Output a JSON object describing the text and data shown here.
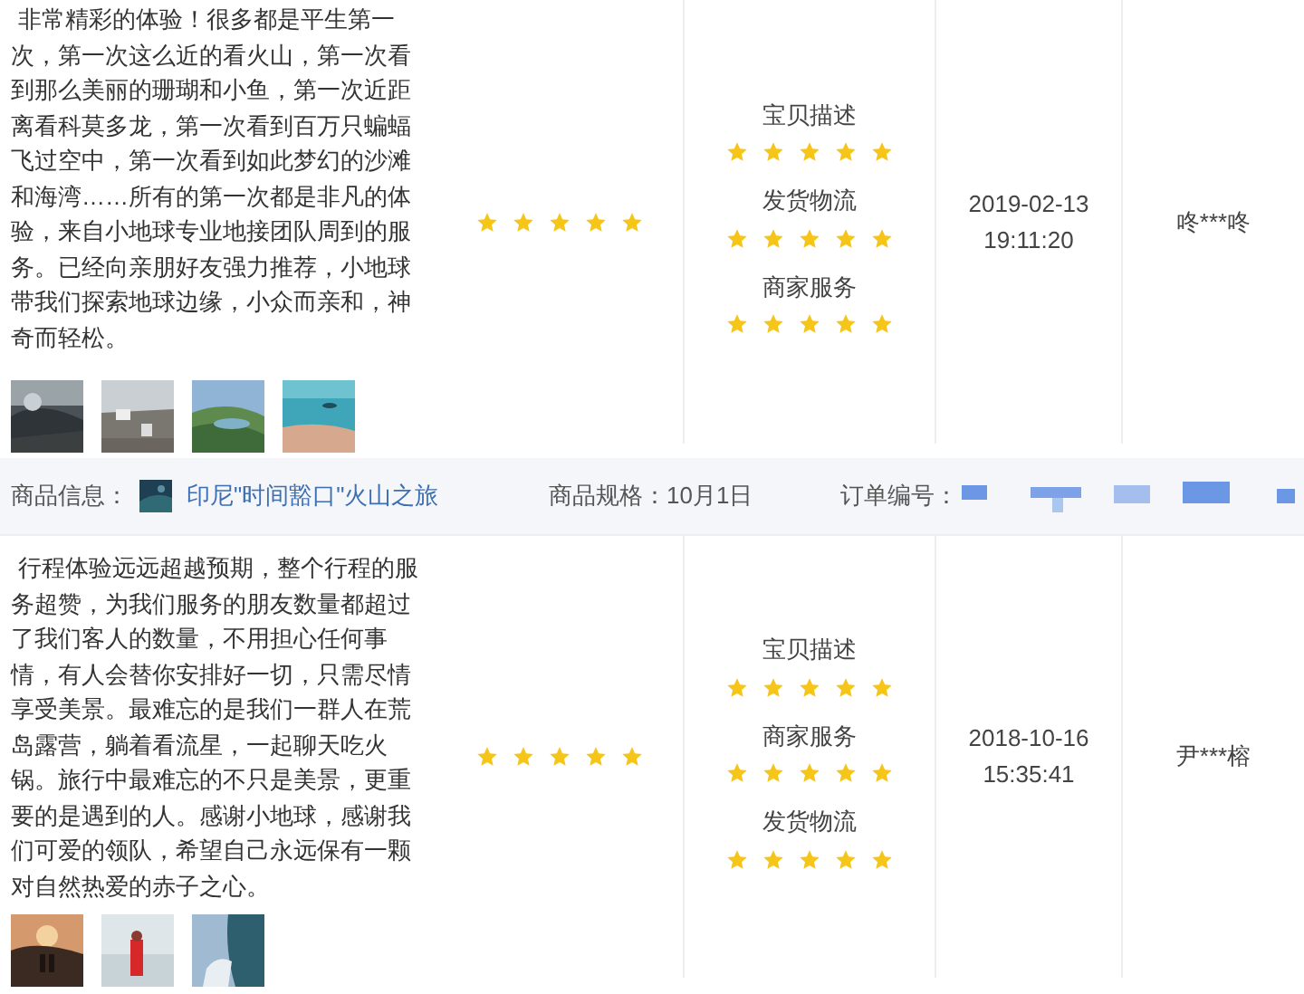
{
  "reviews": [
    {
      "comment": "非常精彩的体验！很多都是平生第一次，第一次这么近的看火山，第一次看到那么美丽的珊瑚和小鱼，第一次近距离看科莫多龙，第一次看到百万只蝙蝠飞过空中，第一次看到如此梦幻的沙滩和海湾……所有的第一次都是非凡的体验，来自小地球专业地接团队周到的服务。已经向亲朋好友强力推荐，小地球带我们探索地球边缘，小众而亲和，神奇而轻松。",
      "photos": [
        {
          "kind": "picture"
        },
        {
          "kind": "picture"
        },
        {
          "kind": "picture"
        },
        {
          "kind": "picture"
        }
      ],
      "stars": 5,
      "ratings": [
        {
          "label": "宝贝描述",
          "stars": 5
        },
        {
          "label": "发货物流",
          "stars": 5
        },
        {
          "label": "商家服务",
          "stars": 5
        }
      ],
      "date": "2019-02-13",
      "time": "19:11:20",
      "user": "咚***咚"
    },
    {
      "info": {
        "product_label": "商品信息：",
        "product": "印尼\"时间豁口\"火山之旅",
        "spec_label": "商品规格：",
        "spec": "10月1日",
        "order_label": "订单编号："
      },
      "comment": "行程体验远远超越预期，整个行程的服务超赞，为我们服务的朋友数量都超过了我们客人的数量，不用担心任何事情，有人会替你安排好一切，只需尽情享受美景。最难忘的是我们一群人在荒岛露营，躺着看流星，一起聊天吃火锅。旅行中最难忘的不只是美景，更重要的是遇到的人。感谢小地球，感谢我们可爱的领队，希望自己永远保有一颗对自然热爱的赤子之心。",
      "photos": [
        {
          "kind": "picture"
        },
        {
          "kind": "picture"
        },
        {
          "kind": "picture"
        }
      ],
      "stars": 5,
      "ratings": [
        {
          "label": "宝贝描述",
          "stars": 5
        },
        {
          "label": "商家服务",
          "stars": 5
        },
        {
          "label": "发货物流",
          "stars": 5
        }
      ],
      "date": "2018-10-16",
      "time": "15:35:41",
      "user": "尹***榕"
    }
  ]
}
